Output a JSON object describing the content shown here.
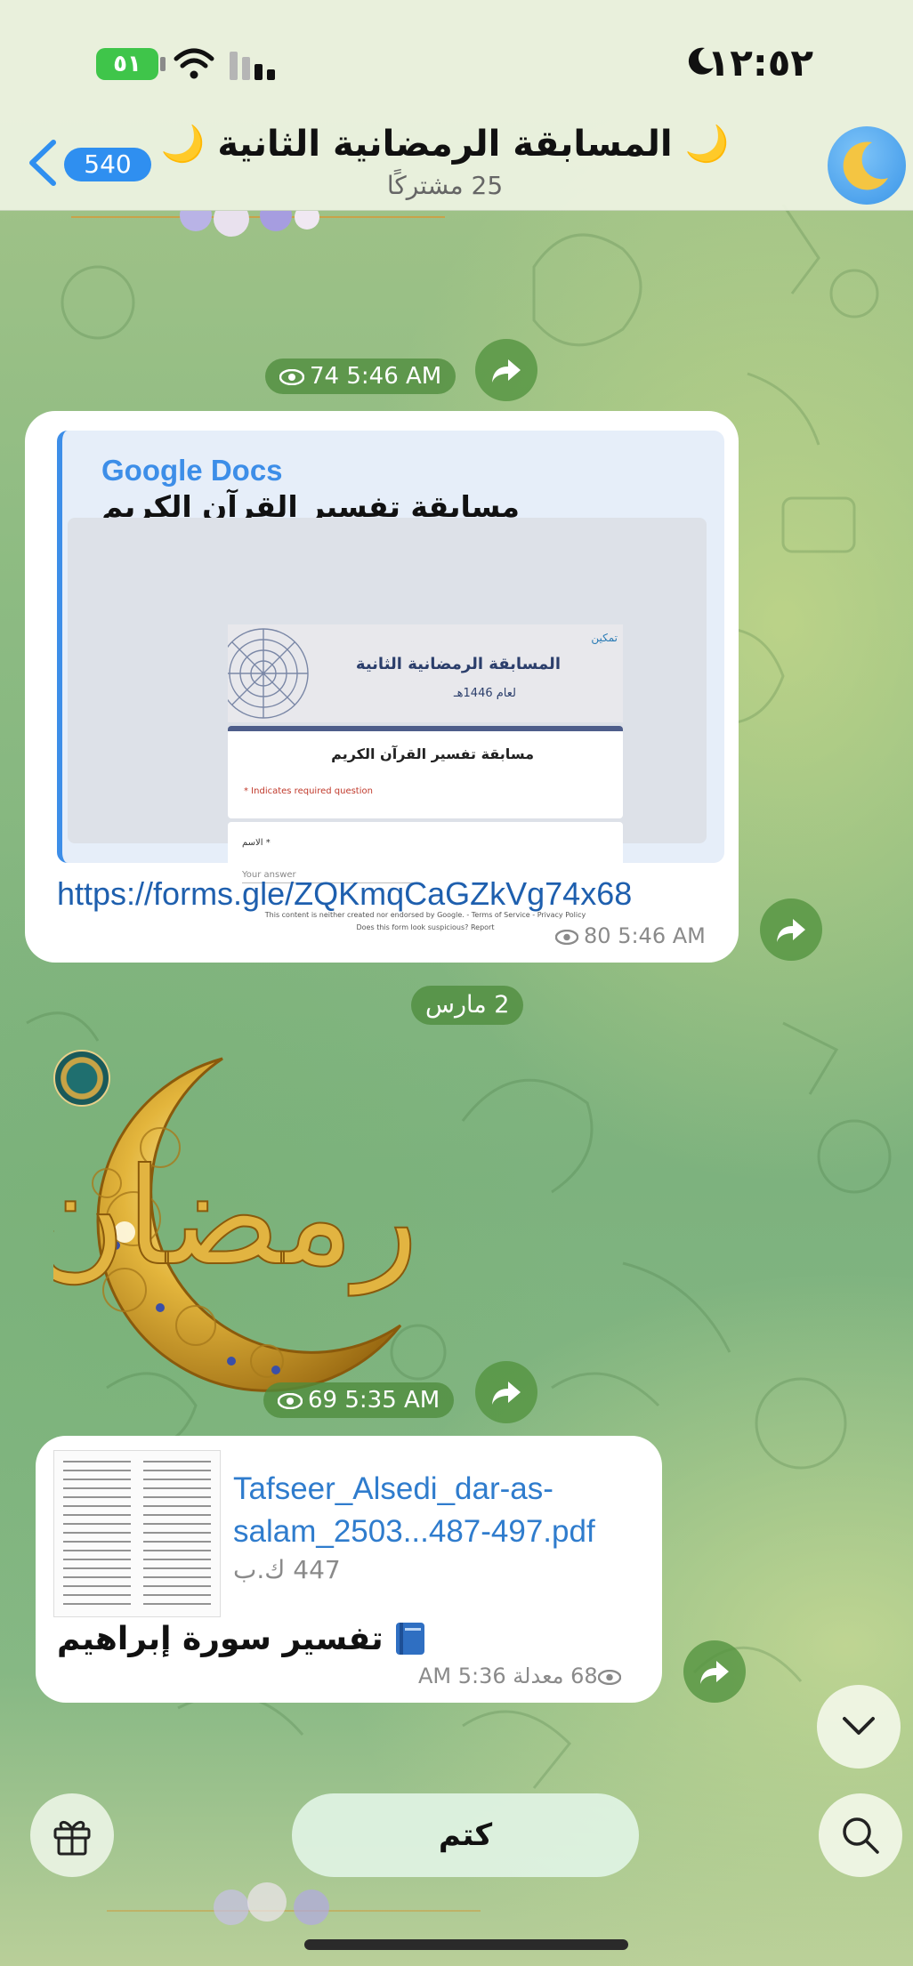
{
  "status_bar": {
    "time": "١٢:٥٢",
    "battery": "٥١"
  },
  "header": {
    "unread_count": "540",
    "channel_title": "🌙 المسابقة الرمضانية الثانية 🌙",
    "subscribers": "25 مشتركًا"
  },
  "messages": [
    {
      "type": "forwarded_sticker_meta",
      "views": "74",
      "time": "5:46 AM"
    },
    {
      "type": "link",
      "preview": {
        "site_name": "Google Docs",
        "title": "مسابقة تفسير القرآن الكريم",
        "banner_title": "المسابقة الرمضانية الثانية",
        "banner_year": "لعام 1446هـ",
        "banner_logo": "تمكين",
        "form_title": "مسابقة تفسير القرآن الكريم",
        "required_note": "* Indicates required question",
        "field_label": "الاسم *",
        "field_placeholder": "Your answer",
        "footer_line1": "This content is neither created nor endorsed by Google. - Terms of Service - Privacy Policy",
        "footer_line2": "Does this form look suspicious? Report"
      },
      "url": "https://forms.gle/ZQKmqCaGZkVg74x68",
      "views": "80",
      "time": "5:46 AM"
    },
    {
      "type": "date_separator",
      "label": "2 مارس"
    },
    {
      "type": "sticker",
      "sticker_text": "٢ رمضان",
      "views": "69",
      "time": "5:35 AM"
    },
    {
      "type": "file",
      "file_name": "Tafseer_Alsedi_dar-as-salam_2503...487-497.pdf",
      "file_size": "447 ك.ب",
      "caption": "تفسير سورة إبراهيم",
      "caption_icon": "book-icon",
      "meta": "68 معدلة AM 5:36"
    }
  ],
  "bottom_bar": {
    "mute_label": "كتم"
  },
  "colors": {
    "accent": "#3d8ee8",
    "link": "#1e5fae",
    "chip_bg": "#4e8c3c"
  }
}
